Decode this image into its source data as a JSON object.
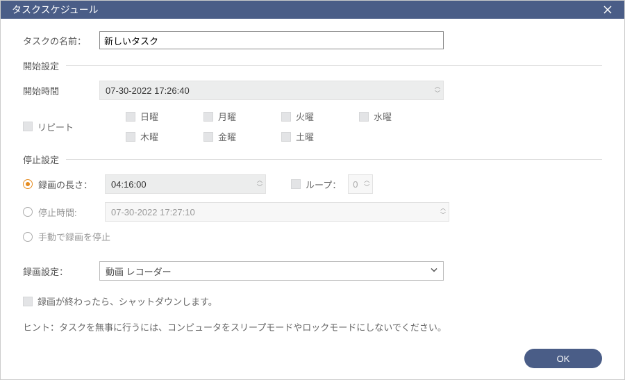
{
  "title": "タスクスケジュール",
  "task_name": {
    "label": "タスクの名前：",
    "value": "新しいタスク"
  },
  "start": {
    "heading": "開始設定",
    "time_label": "開始時間",
    "time_value": "07-30-2022 17:26:40",
    "repeat_label": "リピート",
    "days": {
      "sun": "日曜",
      "mon": "月曜",
      "tue": "火曜",
      "wed": "水曜",
      "thu": "木曜",
      "fri": "金曜",
      "sat": "土曜"
    }
  },
  "stop": {
    "heading": "停止設定",
    "length_label": "録画の長さ：",
    "length_value": "04:16:00",
    "loop_label": "ループ：",
    "loop_value": "0",
    "stop_time_label": "停止時間:",
    "stop_time_value": "07-30-2022 17:27:10",
    "manual_label": "手動で録画を停止"
  },
  "record": {
    "label": "録画設定：",
    "value": "動画 レコーダー"
  },
  "shutdown_label": "録画が終わったら、シャットダウンします。",
  "hint": "ヒント：タスクを無事に行うには、コンピュータをスリープモードやロックモードにしないでください。",
  "ok": "OK"
}
